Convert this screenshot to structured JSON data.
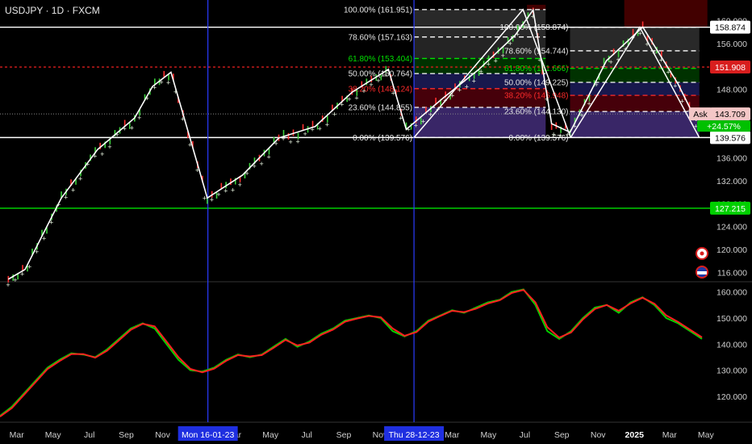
{
  "header": {
    "symbol": "USDJPY · 1D · FXCM"
  },
  "colors": {
    "up": "#e8f5e0",
    "down": "#ff3b3b",
    "blue": "#2a3cff",
    "green": "#00e000",
    "red": "#d81e1e",
    "fib_red": "#ff2b2b"
  },
  "chart_data": [
    {
      "type": "line",
      "title": "",
      "y_scale_ticks": [
        "160.000",
        "156.000",
        "152.000",
        "148.000",
        "144.000",
        "140.000",
        "136.000",
        "132.000",
        "128.000",
        "124.000",
        "120.000",
        "116.000"
      ],
      "ylim": [
        114.5,
        162.5
      ],
      "x_ticks": [
        "Mar",
        "May",
        "Jul",
        "Sep",
        "Nov",
        "Mar",
        "May",
        "Jul",
        "Sep",
        "Nov",
        "Mar",
        "May",
        "Jul",
        "Sep",
        "Nov",
        "2025",
        "Mar",
        "May"
      ],
      "series": [
        {
          "x": [
            "2022-02",
            "2022-03",
            "2022-05",
            "2022-07",
            "2022-09",
            "2022-10",
            "2022-11",
            "2023-01",
            "2023-03",
            "2023-05",
            "2023-07",
            "2023-09",
            "2023-11",
            "2023-12",
            "2024-02",
            "2024-04",
            "2024-06",
            "2024-07",
            "2024-08",
            "2024-09",
            "2024-11",
            "2025-01",
            "2025-03",
            "2025-04"
          ],
          "values": [
            114.8,
            116.5,
            129.0,
            137.5,
            143.0,
            148.5,
            151.0,
            129.0,
            133.0,
            139.5,
            141.5,
            147.5,
            151.5,
            141.0,
            146.5,
            151.5,
            157.5,
            161.9,
            142.0,
            140.5,
            153.0,
            158.9,
            149.0,
            142.5
          ]
        }
      ],
      "annotations": {
        "horizontal_lines": [
          {
            "value": 158.874,
            "label": "158.874",
            "color": "#ffffff"
          },
          {
            "value": 151.908,
            "label": "151.908",
            "color": "#d81e1e"
          },
          {
            "value": 143.709,
            "label": "143.709",
            "color": "#888888"
          },
          {
            "value": 139.576,
            "label": "139.576",
            "color": "#ffffff"
          },
          {
            "value": 127.215,
            "label": "127.215",
            "color": "#00e000"
          }
        ],
        "ask": {
          "label": "Ask",
          "value": "143.709",
          "change": "+24.57%"
        },
        "vertical_markers": [
          {
            "date": "2023-01-16",
            "label": "Mon 16-01-23"
          },
          {
            "date": "2023-12-28",
            "label": "Thu 28-12-23"
          }
        ],
        "fib_left": [
          {
            "value": 161.951,
            "label": "100.00% (161.951)"
          },
          {
            "value": 157.163,
            "label": "78.60% (157.163)"
          },
          {
            "value": 153.404,
            "label": "61.80% (153.404)"
          },
          {
            "value": 150.764,
            "label": "50.00% (150.764)"
          },
          {
            "value": 148.124,
            "label": "38.20% (148.124)"
          },
          {
            "value": 144.855,
            "label": "23.60% (144.855)"
          },
          {
            "value": 139.576,
            "label": "0.00% (139.576)"
          }
        ],
        "fib_right": [
          {
            "value": 158.874,
            "label": "100.00% (158.874)"
          },
          {
            "value": 154.744,
            "label": "78.60% (154.744)"
          },
          {
            "value": 151.666,
            "label": "61.80% (151.666)"
          },
          {
            "value": 149.225,
            "label": "50.00% (149.225)"
          },
          {
            "value": 146.948,
            "label": "38.20% (146.948)"
          },
          {
            "value": 144.13,
            "label": "23.60% (144.130)"
          },
          {
            "value": 139.576,
            "label": "0.00% (139.576)"
          }
        ]
      }
    },
    {
      "type": "line",
      "y_scale_ticks": [
        "160.000",
        "150.000",
        "140.000",
        "130.000",
        "120.000"
      ],
      "ylim": [
        111,
        163
      ],
      "series": [
        {
          "name": "",
          "color": "#00d000",
          "values": [
            112.5,
            116,
            121,
            126,
            131,
            134,
            136.5,
            136,
            135,
            138,
            142,
            146,
            148,
            146,
            140,
            134,
            130,
            129.5,
            131,
            134,
            136,
            135,
            136,
            139,
            142,
            139,
            141,
            144,
            146,
            149,
            150,
            151,
            150,
            145,
            143,
            145,
            149,
            151,
            153,
            152,
            154,
            156,
            157,
            160,
            161,
            155,
            145,
            142,
            145,
            150,
            154,
            155,
            152,
            156,
            158,
            155,
            150,
            148,
            145,
            142
          ]
        },
        {
          "name": "",
          "color": "#ff2020",
          "values": [
            112.2,
            115.5,
            120.5,
            125.5,
            130.5,
            133.5,
            136.2,
            136.2,
            134.8,
            137.5,
            141.5,
            145.5,
            147.8,
            146.8,
            141,
            135,
            130.5,
            129.2,
            130.6,
            133.6,
            135.8,
            135.3,
            135.8,
            138.6,
            141.6,
            139.5,
            140.6,
            143.6,
            145.6,
            148.6,
            149.8,
            150.8,
            150.3,
            146,
            143.2,
            144.6,
            148.6,
            150.8,
            152.8,
            152.3,
            153.6,
            155.6,
            156.8,
            159.6,
            160.8,
            156,
            146.5,
            142.5,
            144.5,
            149.5,
            153.5,
            155,
            152.8,
            155.6,
            157.8,
            155.5,
            151,
            148.5,
            145.5,
            142.6
          ]
        }
      ]
    }
  ]
}
